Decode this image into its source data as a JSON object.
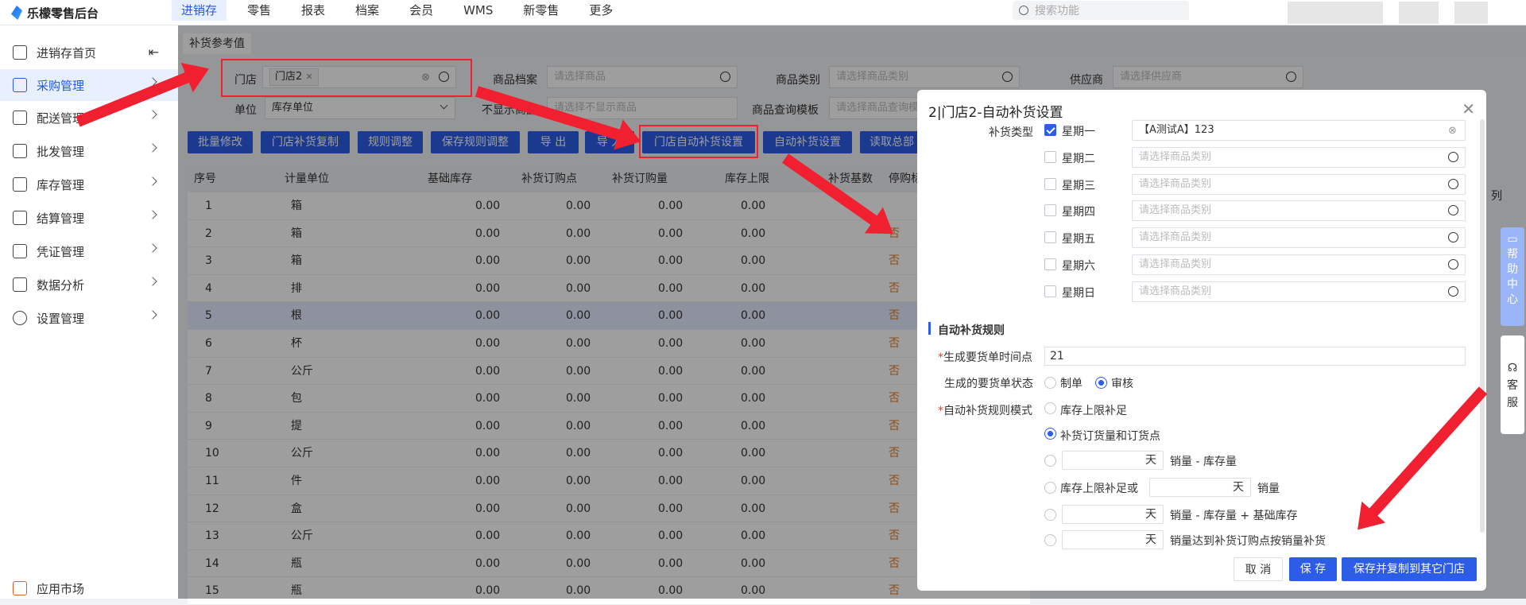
{
  "app": {
    "title": "乐檬零售后台"
  },
  "nav": [
    "进销存",
    "零售",
    "报表",
    "档案",
    "会员",
    "WMS",
    "新零售",
    "更多"
  ],
  "search": {
    "placeholder": "搜索功能"
  },
  "sidebar": [
    "进销存首页",
    "采购管理",
    "配送管理",
    "批发管理",
    "库存管理",
    "结算管理",
    "凭证管理",
    "数据分析",
    "设置管理"
  ],
  "sidebar_bottom": "应用市场",
  "page_tab": "补货参考值",
  "filters": {
    "store_label": "门店",
    "store_tag": "门店2",
    "product_label": "商品档案",
    "product_ph": "请选择商品",
    "category_label": "商品类别",
    "category_ph": "请选择商品类别",
    "supplier_label": "供应商",
    "supplier_ph": "请选择供应商",
    "unit_label": "单位",
    "unit_value": "库存单位",
    "hide_label": "不显示商品",
    "hide_ph": "请选择不显示商品",
    "template_label": "商品查询模板",
    "template_ph": "请选择商品查询模板"
  },
  "buttons": [
    "批量修改",
    "门店补货复制",
    "规则调整",
    "保存规则调整",
    "导 出",
    "导 入",
    "门店自动补货设置",
    "自动补货设置",
    "读取总部"
  ],
  "table": {
    "headers": [
      "序号",
      "计量单位",
      "基础库存",
      "补货订购点",
      "补货订购量",
      "库存上限",
      "补货基数",
      "停购标"
    ],
    "rows": [
      [
        "1",
        "箱",
        "0.00",
        "0.00",
        "0.00",
        "0.00",
        ""
      ],
      [
        "2",
        "箱",
        "0.00",
        "0.00",
        "0.00",
        "0.00",
        "否"
      ],
      [
        "3",
        "箱",
        "0.00",
        "0.00",
        "0.00",
        "0.00",
        "否"
      ],
      [
        "4",
        "排",
        "0.00",
        "0.00",
        "0.00",
        "0.00",
        "否"
      ],
      [
        "5",
        "根",
        "0.00",
        "0.00",
        "0.00",
        "0.00",
        "否"
      ],
      [
        "6",
        "杯",
        "0.00",
        "0.00",
        "0.00",
        "0.00",
        "否"
      ],
      [
        "7",
        "公斤",
        "0.00",
        "0.00",
        "0.00",
        "0.00",
        "否"
      ],
      [
        "8",
        "包",
        "0.00",
        "0.00",
        "0.00",
        "0.00",
        "否"
      ],
      [
        "9",
        "提",
        "0.00",
        "0.00",
        "0.00",
        "0.00",
        "否"
      ],
      [
        "10",
        "公斤",
        "0.00",
        "0.00",
        "0.00",
        "0.00",
        "否"
      ],
      [
        "11",
        "件",
        "0.00",
        "0.00",
        "0.00",
        "0.00",
        "否"
      ],
      [
        "12",
        "盒",
        "0.00",
        "0.00",
        "0.00",
        "0.00",
        "否"
      ],
      [
        "13",
        "公斤",
        "0.00",
        "0.00",
        "0.00",
        "0.00",
        "否"
      ],
      [
        "14",
        "瓶",
        "0.00",
        "0.00",
        "0.00",
        "0.00",
        "否"
      ],
      [
        "15",
        "瓶",
        "0.00",
        "0.00",
        "0.00",
        "0.00",
        "否"
      ]
    ]
  },
  "col_label": "列",
  "help": "帮助中心",
  "service": "客服",
  "modal": {
    "title": "2|门店2-自动补货设置",
    "type_label": "补货类型",
    "weekdays": [
      {
        "label": "星期一",
        "value": "【A测试A】123",
        "checked": true
      },
      {
        "label": "星期二",
        "value": "请选择商品类别",
        "checked": false
      },
      {
        "label": "星期三",
        "value": "请选择商品类别",
        "checked": false
      },
      {
        "label": "星期四",
        "value": "请选择商品类别",
        "checked": false
      },
      {
        "label": "星期五",
        "value": "请选择商品类别",
        "checked": false
      },
      {
        "label": "星期六",
        "value": "请选择商品类别",
        "checked": false
      },
      {
        "label": "星期日",
        "value": "请选择商品类别",
        "checked": false
      }
    ],
    "rules_title": "自动补货规则",
    "time_label": "生成要货单时间点",
    "time_value": "21",
    "status_label": "生成的要货单状态",
    "status_opts": [
      "制单",
      "审核"
    ],
    "mode_label": "自动补货规则模式",
    "modes": [
      "库存上限补足",
      "补货订货量和订货点"
    ],
    "day_unit": "天",
    "formula1": "销量 - 库存量",
    "formula2a": "库存上限补足或",
    "formula2b": "销量",
    "formula3": "销量 - 库存量 + 基础库存",
    "formula4": "销量达到补货订购点按销量补货",
    "cancel": "取 消",
    "save": "保 存",
    "save_copy": "保存并复制到其它门店"
  }
}
